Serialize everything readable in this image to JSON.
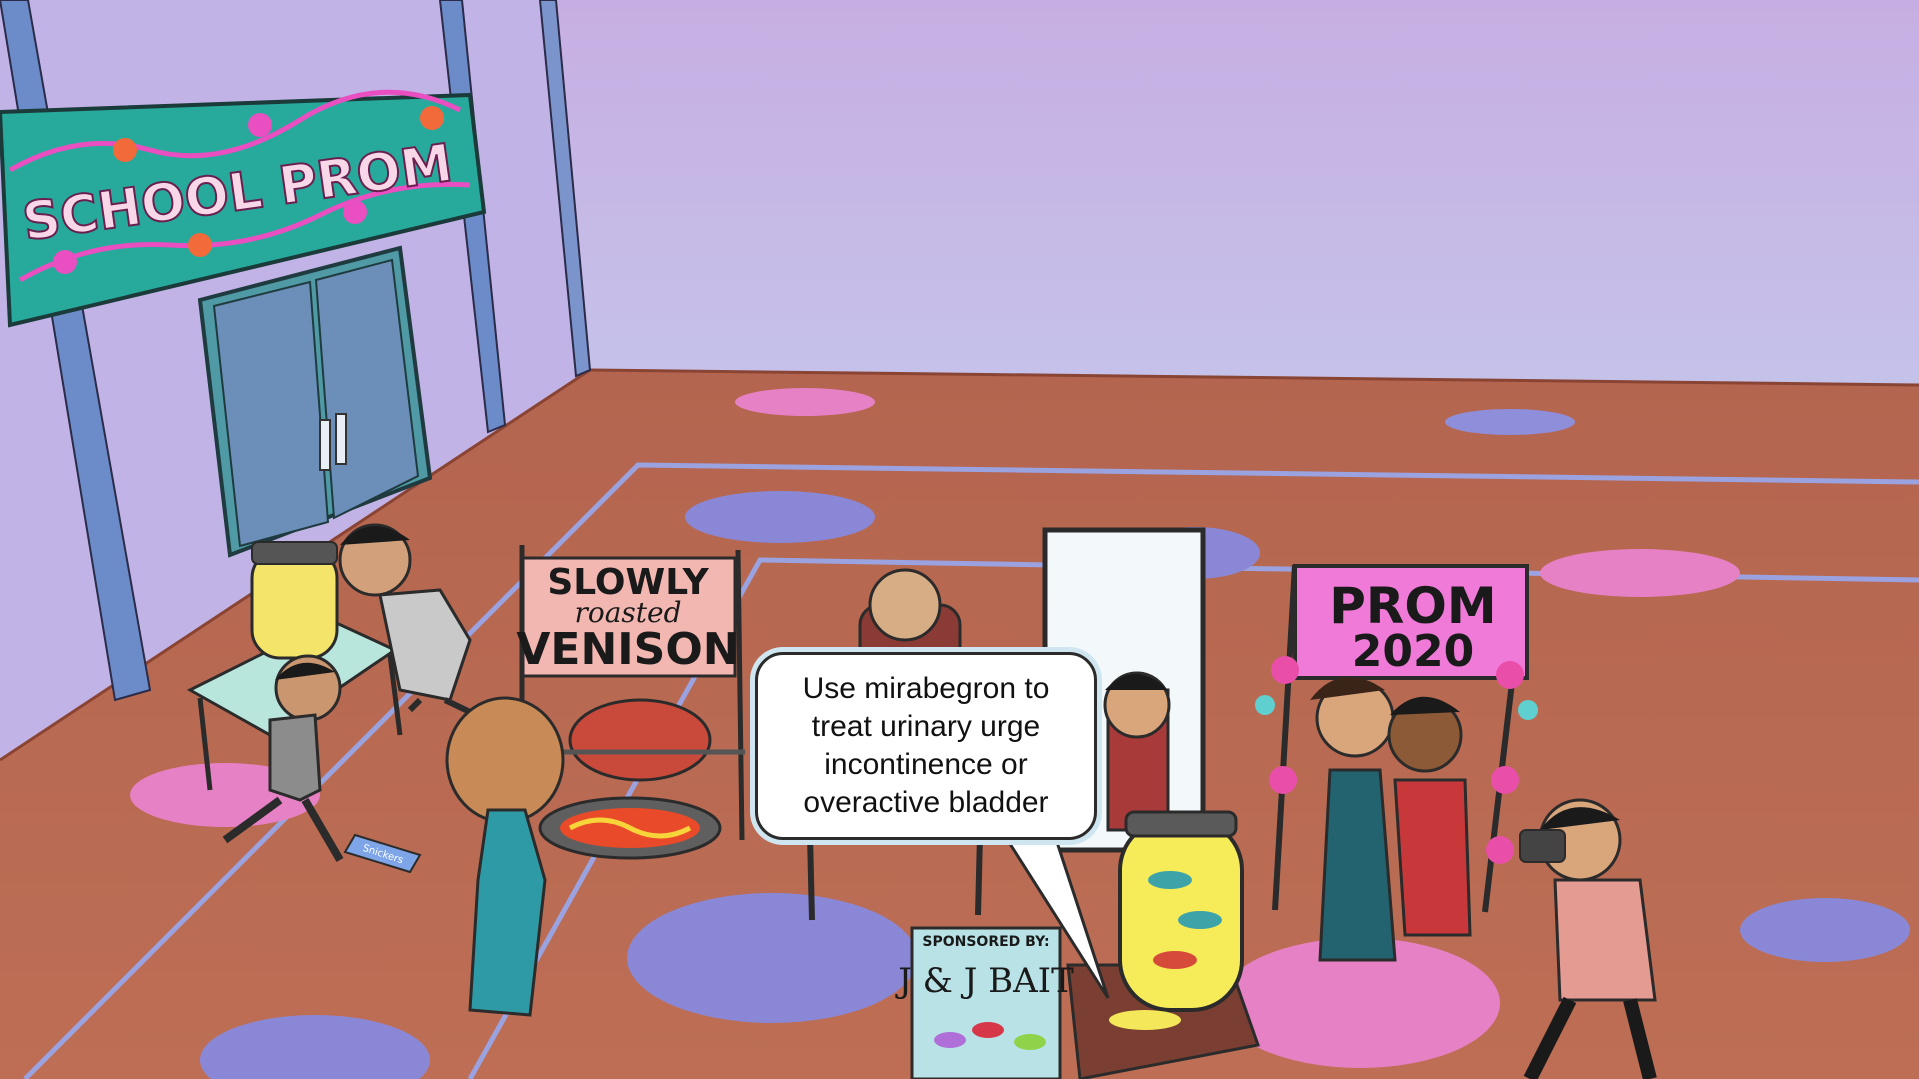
{
  "scene": {
    "banner_text": "SCHOOL PROM",
    "venison_sign": {
      "line1": "SLOWLY",
      "line2": "roasted",
      "line3": "VENISON"
    },
    "prom_sign": {
      "line1": "PROM",
      "line2": "2020"
    },
    "sponsor_sign": {
      "label": "SPONSORED BY:",
      "name": "J & J BAIT"
    },
    "candy_bar_label": "Snickers",
    "speech_bubble": {
      "lines": [
        "Use mirabegron to",
        "treat urinary urge",
        "incontinence or",
        "overactive bladder"
      ]
    }
  },
  "colors": {
    "wall": "#c5b3e2",
    "floor": "#b8684f",
    "banner": "#2aa79a",
    "prom_sign": "#f07ad8",
    "court_line": "#9aa2e0"
  }
}
